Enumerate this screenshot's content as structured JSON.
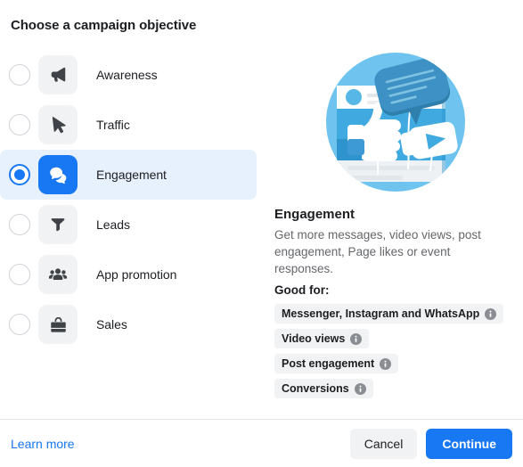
{
  "dialog": {
    "title": "Choose a campaign objective"
  },
  "objectives": [
    {
      "id": "awareness",
      "label": "Awareness",
      "icon": "megaphone-icon",
      "selected": false
    },
    {
      "id": "traffic",
      "label": "Traffic",
      "icon": "cursor-arrow-icon",
      "selected": false
    },
    {
      "id": "engagement",
      "label": "Engagement",
      "icon": "speech-bubbles-icon",
      "selected": true
    },
    {
      "id": "leads",
      "label": "Leads",
      "icon": "funnel-icon",
      "selected": false
    },
    {
      "id": "app-promotion",
      "label": "App promotion",
      "icon": "people-group-icon",
      "selected": false
    },
    {
      "id": "sales",
      "label": "Sales",
      "icon": "shopping-bag-icon",
      "selected": false
    }
  ],
  "detail": {
    "illustration": "engagement-illustration",
    "heading": "Engagement",
    "description": "Get more messages, video views, post engagement, Page likes or event responses.",
    "good_for_label": "Good for:",
    "tags": [
      {
        "label": "Messenger, Instagram and WhatsApp",
        "icon": "info-icon"
      },
      {
        "label": "Video views",
        "icon": "info-icon"
      },
      {
        "label": "Post engagement",
        "icon": "info-icon"
      },
      {
        "label": "Conversions",
        "icon": "info-icon"
      }
    ]
  },
  "footer": {
    "learn_more": "Learn more",
    "cancel": "Cancel",
    "continue": "Continue"
  },
  "colors": {
    "accent": "#1877f2",
    "selected_row_bg": "#e7f0fd",
    "tile_bg": "#f1f2f3",
    "text_primary": "#1c1e21",
    "text_secondary": "#65676b",
    "divider": "#e4e6eb"
  }
}
